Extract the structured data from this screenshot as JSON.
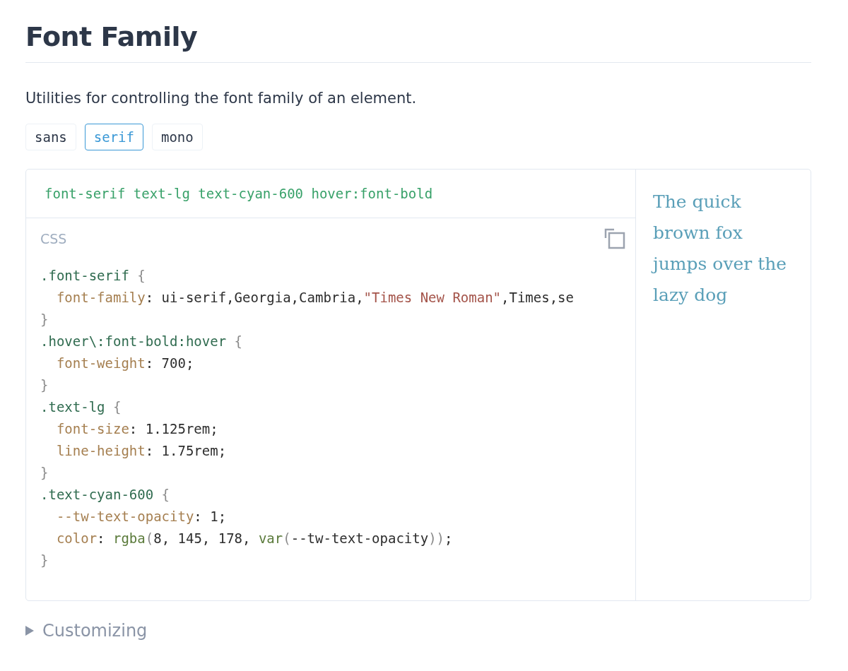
{
  "title": "Font Family",
  "description": "Utilities for controlling the font family of an element.",
  "tabs": [
    {
      "label": "sans",
      "selected": false
    },
    {
      "label": "serif",
      "selected": true
    },
    {
      "label": "mono",
      "selected": false
    }
  ],
  "classes": "font-serif text-lg text-cyan-600 hover:font-bold",
  "code_language": "CSS",
  "code_lines": [
    {
      "indented": false,
      "tokens": [
        {
          "kind": "selector",
          "text": ".font-serif"
        },
        {
          "kind": "punct",
          "text": " {"
        }
      ]
    },
    {
      "indented": true,
      "tokens": [
        {
          "kind": "prop",
          "text": "font-family"
        },
        {
          "kind": "plain",
          "text": ": ui-serif,Georgia,Cambria,"
        },
        {
          "kind": "string",
          "text": "\"Times New Roman\""
        },
        {
          "kind": "plain",
          "text": ",Times,se"
        }
      ]
    },
    {
      "indented": false,
      "tokens": [
        {
          "kind": "punct",
          "text": "}"
        }
      ]
    },
    {
      "indented": false,
      "tokens": [
        {
          "kind": "selector",
          "text": ".hover\\:font-bold:hover"
        },
        {
          "kind": "punct",
          "text": " {"
        }
      ]
    },
    {
      "indented": true,
      "tokens": [
        {
          "kind": "prop",
          "text": "font-weight"
        },
        {
          "kind": "plain",
          "text": ": 700;"
        }
      ]
    },
    {
      "indented": false,
      "tokens": [
        {
          "kind": "punct",
          "text": "}"
        }
      ]
    },
    {
      "indented": false,
      "tokens": [
        {
          "kind": "selector",
          "text": ".text-lg"
        },
        {
          "kind": "punct",
          "text": " {"
        }
      ]
    },
    {
      "indented": true,
      "tokens": [
        {
          "kind": "prop",
          "text": "font-size"
        },
        {
          "kind": "plain",
          "text": ": 1.125rem;"
        }
      ]
    },
    {
      "indented": true,
      "tokens": [
        {
          "kind": "prop",
          "text": "line-height"
        },
        {
          "kind": "plain",
          "text": ": 1.75rem;"
        }
      ]
    },
    {
      "indented": false,
      "tokens": [
        {
          "kind": "punct",
          "text": "}"
        }
      ]
    },
    {
      "indented": false,
      "tokens": [
        {
          "kind": "selector",
          "text": ".text-cyan-600"
        },
        {
          "kind": "punct",
          "text": " {"
        }
      ]
    },
    {
      "indented": true,
      "tokens": [
        {
          "kind": "prop",
          "text": "--tw-text-opacity"
        },
        {
          "kind": "plain",
          "text": ": 1;"
        }
      ]
    },
    {
      "indented": true,
      "tokens": [
        {
          "kind": "prop",
          "text": "color"
        },
        {
          "kind": "plain",
          "text": ": "
        },
        {
          "kind": "func",
          "text": "rgba"
        },
        {
          "kind": "punct",
          "text": "("
        },
        {
          "kind": "plain",
          "text": "8, 145, 178, "
        },
        {
          "kind": "func",
          "text": "var"
        },
        {
          "kind": "punct",
          "text": "("
        },
        {
          "kind": "plain",
          "text": "--tw-text-opacity"
        },
        {
          "kind": "punct",
          "text": "))"
        },
        {
          "kind": "plain",
          "text": ";"
        }
      ]
    },
    {
      "indented": false,
      "tokens": [
        {
          "kind": "punct",
          "text": "}"
        }
      ]
    }
  ],
  "preview": "The quick brown fox jumps over the lazy dog",
  "disclosure": {
    "label": "Customizing",
    "expanded": false
  }
}
